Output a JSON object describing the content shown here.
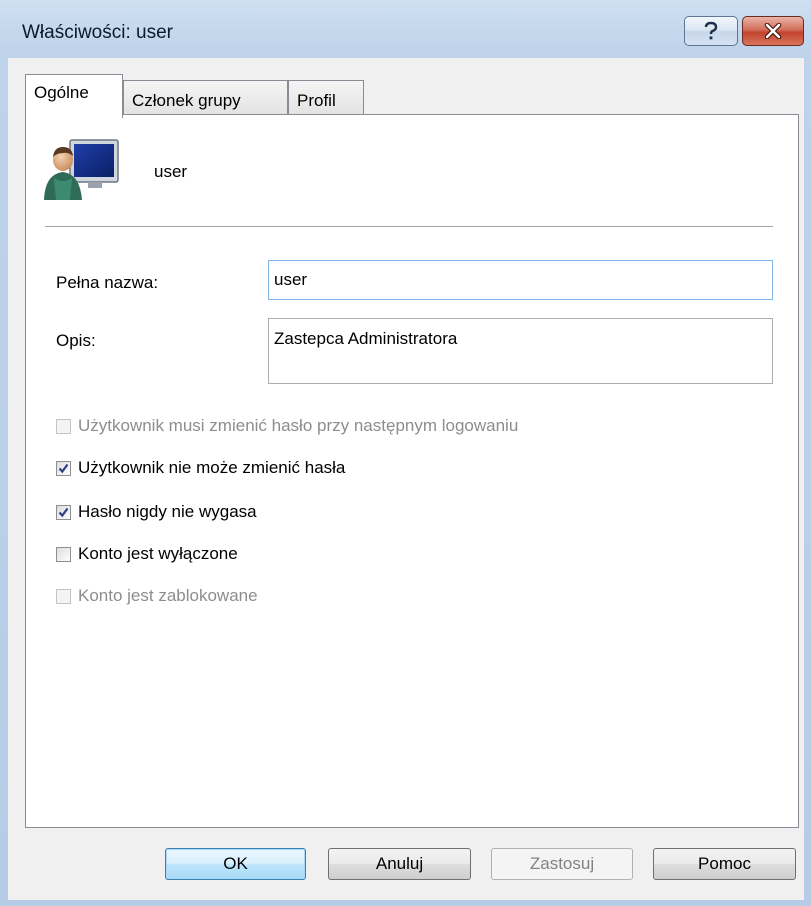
{
  "window": {
    "title": "Właściwości: user"
  },
  "tabs": [
    {
      "label": "Ogólne",
      "active": true
    },
    {
      "label": "Członek grupy",
      "active": false
    },
    {
      "label": "Profil",
      "active": false
    }
  ],
  "header": {
    "user_name": "user"
  },
  "form": {
    "full_name_label": "Pełna nazwa:",
    "full_name_value": "user",
    "description_label": "Opis:",
    "description_value": "Zastepca Administratora"
  },
  "checkboxes": [
    {
      "label": "Użytkownik musi zmienić hasło przy następnym logowaniu",
      "checked": false,
      "enabled": false
    },
    {
      "label": "Użytkownik nie może zmienić hasła",
      "checked": true,
      "enabled": true
    },
    {
      "label": "Hasło nigdy nie wygasa",
      "checked": true,
      "enabled": true
    },
    {
      "label": "Konto jest wyłączone",
      "checked": false,
      "enabled": true
    },
    {
      "label": "Konto jest zablokowane",
      "checked": false,
      "enabled": false
    }
  ],
  "buttons": {
    "ok": "OK",
    "cancel": "Anuluj",
    "apply": "Zastosuj",
    "help": "Pomoc"
  },
  "icons": {
    "help": "help-question-icon",
    "close": "close-x-icon",
    "user": "user-computer-icon"
  }
}
